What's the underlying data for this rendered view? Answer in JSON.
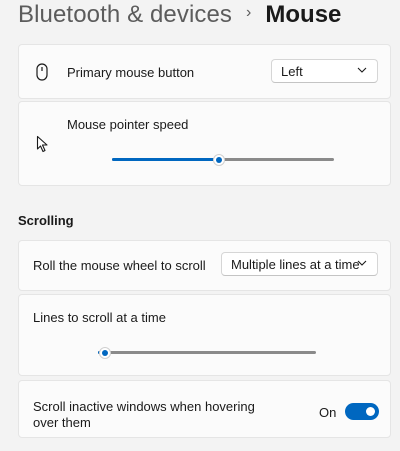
{
  "breadcrumb": {
    "parent": "Bluetooth & devices",
    "separator": "›",
    "current": "Mouse"
  },
  "primary_button": {
    "label": "Primary mouse button",
    "value": "Left",
    "icon": "mouse-icon"
  },
  "pointer_speed": {
    "label": "Mouse pointer speed",
    "icon": "pointer-arrow-icon",
    "level": 0.48
  },
  "scrolling": {
    "heading": "Scrolling",
    "roll": {
      "label": "Roll the mouse wheel to scroll",
      "value": "Multiple lines at a time"
    },
    "lines": {
      "label": "Lines to scroll at a time",
      "level": 0.03
    },
    "inactive": {
      "label_line1": "Scroll inactive windows when hovering",
      "label_line2": "over them",
      "state": "On",
      "on": true
    }
  },
  "colors": {
    "accent": "#0067c0",
    "background": "#f3f3f3",
    "card": "#fbfbfb"
  }
}
